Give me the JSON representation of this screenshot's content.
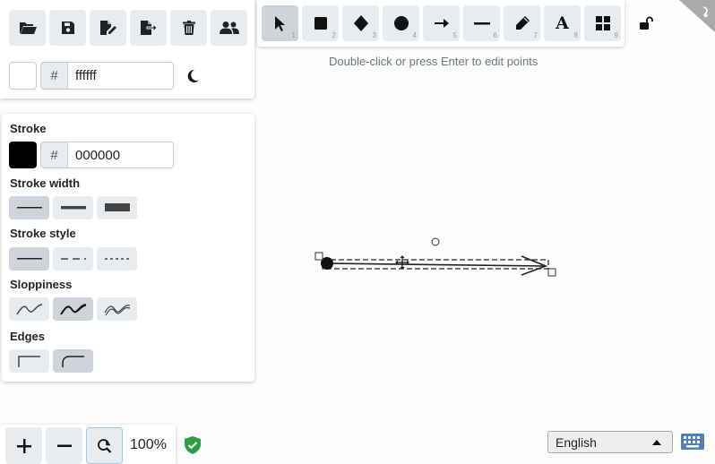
{
  "menu": {
    "buttons": [
      {
        "name": "open-button",
        "icon": "folder-open-icon"
      },
      {
        "name": "save-button",
        "icon": "floppy-disk-icon"
      },
      {
        "name": "save-as-button",
        "icon": "file-edit-icon"
      },
      {
        "name": "export-button",
        "icon": "file-export-icon"
      },
      {
        "name": "clear-canvas-button",
        "icon": "trash-icon"
      },
      {
        "name": "collaborate-button",
        "icon": "users-icon"
      }
    ],
    "background_hash": "#",
    "background_value": "ffffff",
    "background_color": "#ffffff",
    "theme_icon": "moon-icon"
  },
  "tools": {
    "items": [
      {
        "name": "selection",
        "icon": "pointer-icon",
        "shortcut": "1",
        "selected": true
      },
      {
        "name": "rectangle",
        "icon": "square-icon",
        "shortcut": "2"
      },
      {
        "name": "diamond",
        "icon": "diamond-icon",
        "shortcut": "3"
      },
      {
        "name": "ellipse",
        "icon": "circle-icon",
        "shortcut": "4"
      },
      {
        "name": "arrow",
        "icon": "arrow-right-icon",
        "shortcut": "5"
      },
      {
        "name": "line",
        "icon": "line-icon",
        "shortcut": "6"
      },
      {
        "name": "draw",
        "icon": "pencil-icon",
        "shortcut": "7"
      },
      {
        "name": "text",
        "icon": "text-a-icon",
        "glyph": "A",
        "shortcut": "8"
      },
      {
        "name": "library",
        "icon": "grid-icon",
        "shortcut": "9"
      }
    ],
    "lock_icon": "unlock-icon"
  },
  "hint": "Double-click or press Enter to edit points",
  "properties": {
    "stroke_label": "Stroke",
    "stroke_hash": "#",
    "stroke_value": "000000",
    "stroke_color": "#000000",
    "stroke_width_label": "Stroke width",
    "stroke_style_label": "Stroke style",
    "sloppiness_label": "Sloppiness",
    "edges_label": "Edges"
  },
  "footer": {
    "zoom_in_icon": "plus-icon",
    "zoom_out_icon": "minus-icon",
    "reset_zoom_icon": "zoom-reset-icon",
    "zoom_level": "100%",
    "shield_icon": "shield-check-icon",
    "language": "English",
    "keyboard_icon": "keyboard-icon"
  }
}
